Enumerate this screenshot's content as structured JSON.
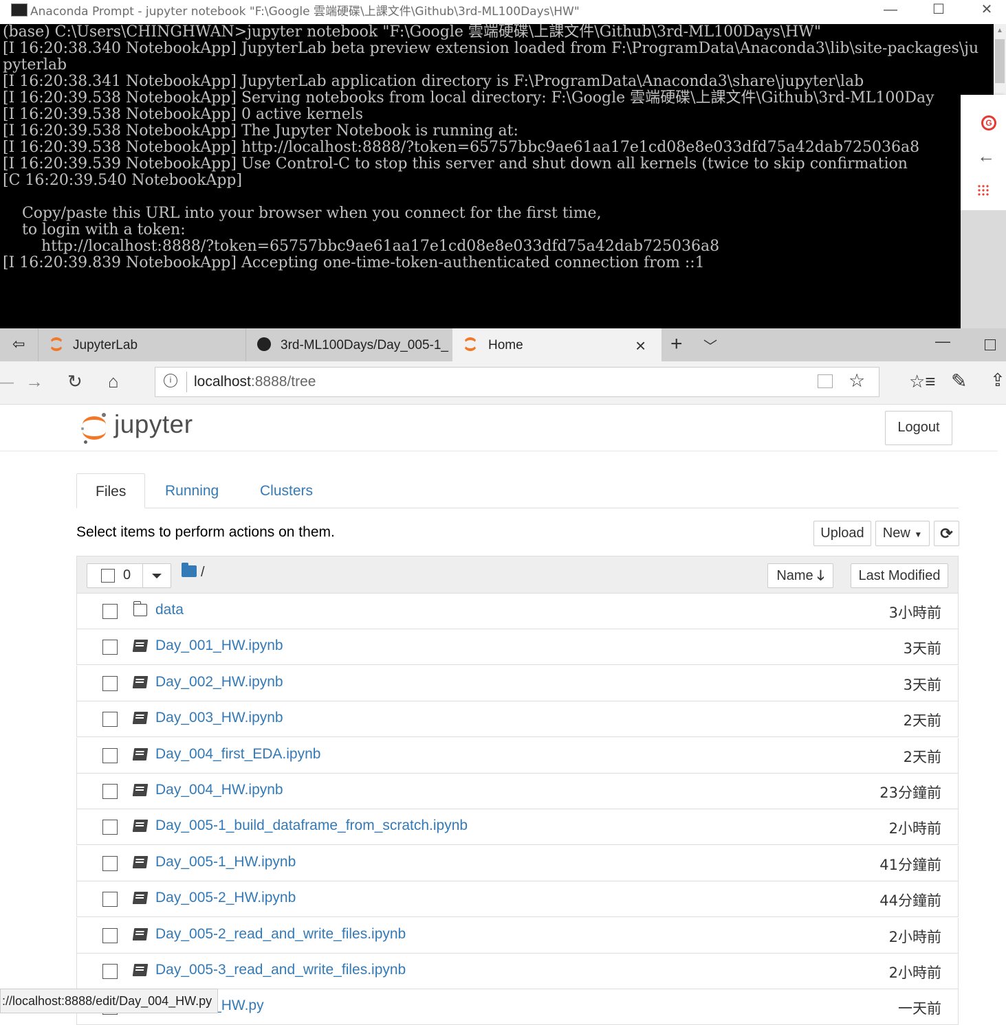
{
  "console": {
    "title": "Anaconda Prompt - jupyter  notebook \"F:\\Google 雲端硬碟\\上課文件\\Github\\3rd-ML100Days\\HW\"",
    "lines": [
      "(base) C:\\Users\\CHINGHWAN>jupyter notebook \"F:\\Google 雲端硬碟\\上課文件\\Github\\3rd-ML100Days\\HW\"",
      "[I 16:20:38.340 NotebookApp] JupyterLab beta preview extension loaded from F:\\ProgramData\\Anaconda3\\lib\\site-packages\\ju",
      "pyterlab",
      "[I 16:20:38.341 NotebookApp] JupyterLab application directory is F:\\ProgramData\\Anaconda3\\share\\jupyter\\lab",
      "[I 16:20:39.538 NotebookApp] Serving notebooks from local directory: F:\\Google 雲端硬碟\\上課文件\\Github\\3rd-ML100Day",
      "[I 16:20:39.538 NotebookApp] 0 active kernels",
      "[I 16:20:39.538 NotebookApp] The Jupyter Notebook is running at:",
      "[I 16:20:39.538 NotebookApp] http://localhost:8888/?token=65757bbc9ae61aa17e1cd08e8e033dfd75a42dab725036a8",
      "[I 16:20:39.539 NotebookApp] Use Control-C to stop this server and shut down all kernels (twice to skip confirmation",
      "[C 16:20:39.540 NotebookApp]",
      "",
      "    Copy/paste this URL into your browser when you connect for the first time,",
      "    to login with a token:",
      "        http://localhost:8888/?token=65757bbc9ae61aa17e1cd08e8e033dfd75a42dab725036a8",
      "[I 16:20:39.839 NotebookApp] Accepting one-time-token-authenticated connection from ::1"
    ]
  },
  "browser": {
    "tabs": [
      {
        "label": "JupyterLab",
        "icon": "jupyter-icon"
      },
      {
        "label": "3rd-ML100Days/Day_005-1_",
        "icon": "github-icon"
      },
      {
        "label": "Home",
        "icon": "jupyter-icon",
        "active": true
      }
    ],
    "url_host": "localhost",
    "url_rest": ":8888/tree",
    "status_url": "://localhost:8888/edit/Day_004_HW.py"
  },
  "jupyter": {
    "brand": "jupyter",
    "logout_label": "Logout",
    "tabs": {
      "files": "Files",
      "running": "Running",
      "clusters": "Clusters"
    },
    "hint": "Select items to perform actions on them.",
    "upload_label": "Upload",
    "new_label": "New",
    "selected_count": "0",
    "path": "/",
    "sort_name_label": "Name",
    "sort_modified_label": "Last Modified",
    "files": [
      {
        "name": "data",
        "type": "folder",
        "modified": "3小時前"
      },
      {
        "name": "Day_001_HW.ipynb",
        "type": "notebook",
        "modified": "3天前"
      },
      {
        "name": "Day_002_HW.ipynb",
        "type": "notebook",
        "modified": "3天前"
      },
      {
        "name": "Day_003_HW.ipynb",
        "type": "notebook",
        "modified": "2天前"
      },
      {
        "name": "Day_004_first_EDA.ipynb",
        "type": "notebook",
        "modified": "2天前"
      },
      {
        "name": "Day_004_HW.ipynb",
        "type": "notebook",
        "modified": "23分鐘前"
      },
      {
        "name": "Day_005-1_build_dataframe_from_scratch.ipynb",
        "type": "notebook",
        "modified": "2小時前"
      },
      {
        "name": "Day_005-1_HW.ipynb",
        "type": "notebook",
        "modified": "41分鐘前"
      },
      {
        "name": "Day_005-2_HW.ipynb",
        "type": "notebook",
        "modified": "44分鐘前"
      },
      {
        "name": "Day_005-2_read_and_write_files.ipynb",
        "type": "notebook",
        "modified": "2小時前"
      },
      {
        "name": "Day_005-3_read_and_write_files.ipynb",
        "type": "notebook",
        "modified": "2小時前"
      },
      {
        "name": "Day_004_HW.py",
        "type": "file",
        "modified": "一天前"
      }
    ]
  },
  "colors": {
    "link": "#337ab7",
    "jupyter_orange": "#f37726",
    "console_bg": "#000000",
    "console_fg": "#c0c0c0"
  }
}
